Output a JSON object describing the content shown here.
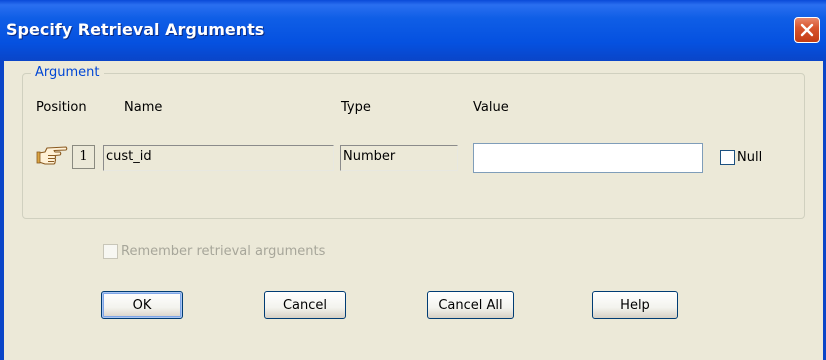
{
  "window": {
    "title": "Specify Retrieval Arguments"
  },
  "argument_group": {
    "legend": "Argument",
    "headers": {
      "position": "Position",
      "name": "Name",
      "type": "Type",
      "value": "Value"
    },
    "rows": [
      {
        "position": "1",
        "name": "cust_id",
        "type": "Number",
        "value": "",
        "null_label": "Null",
        "null_checked": false
      }
    ]
  },
  "remember": {
    "label": "Remember retrieval arguments",
    "enabled": false,
    "checked": false
  },
  "buttons": {
    "ok": "OK",
    "cancel": "Cancel",
    "cancel_all": "Cancel All",
    "help": "Help"
  },
  "icons": {
    "close": "close-icon",
    "pointer": "pointing-hand-icon"
  },
  "colors": {
    "titlebar": "#0551e0",
    "legend": "#0046d5",
    "close": "#c33c14",
    "face": "#ece9d8"
  }
}
